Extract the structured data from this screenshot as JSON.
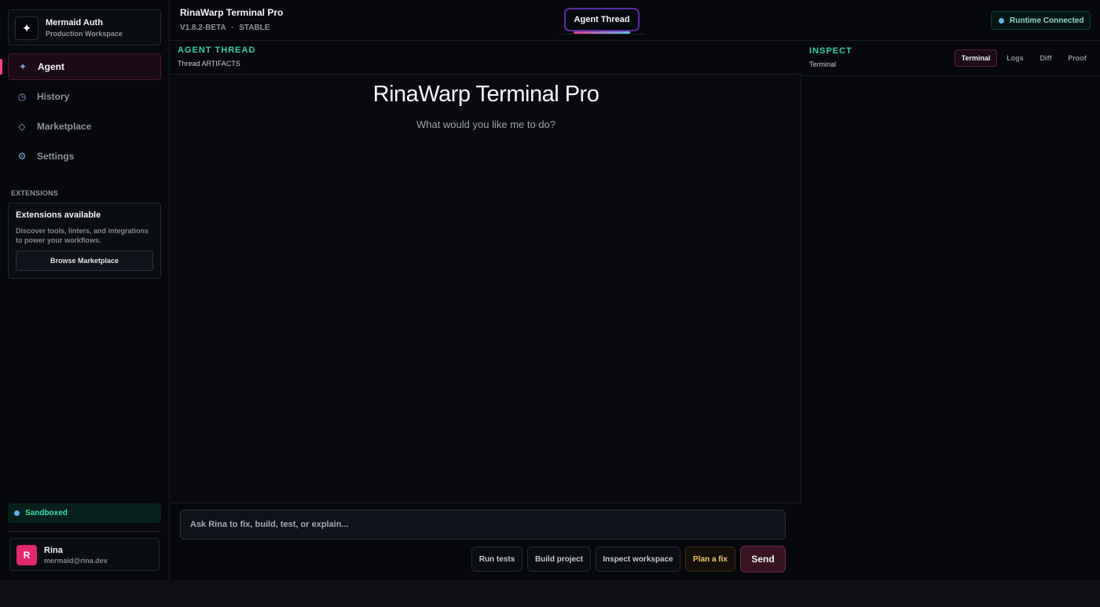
{
  "workspace": {
    "name": "Mermaid Auth",
    "subtitle": "Production Workspace",
    "logo_icon": "sparkle-icon"
  },
  "nav": [
    {
      "label": "Agent",
      "icon": "sparkle-icon",
      "glyph": "✦",
      "active": true
    },
    {
      "label": "History",
      "icon": "clock-icon",
      "glyph": "◷",
      "active": false
    },
    {
      "label": "Marketplace",
      "icon": "diamond-icon",
      "glyph": "◇",
      "active": false
    },
    {
      "label": "Settings",
      "icon": "gear-icon",
      "glyph": "⚙",
      "active": false
    }
  ],
  "extensions": {
    "header": "EXTENSIONS",
    "card_title": "Extensions available",
    "card_desc": "Discover tools, linters, and integrations to power your workflows.",
    "button": "Browse Marketplace"
  },
  "sandbox": {
    "label": "Sandboxed"
  },
  "user": {
    "initial": "R",
    "name": "Rina",
    "email": "mermaid@rina.dev"
  },
  "header": {
    "title": "RinaWarp Terminal Pro",
    "version": "V1.8.2-BETA",
    "separator": "·",
    "channel": "STABLE",
    "active_tab": "Agent Thread",
    "runtime_status": "Runtime Connected"
  },
  "thread": {
    "label": "AGENT THREAD",
    "sublabel": "Thread ARTIFACTS",
    "hero_title": "RinaWarp Terminal Pro",
    "hero_subtitle": "What would you like me to do?"
  },
  "composer": {
    "placeholder": "Ask Rina to fix, build, test, or explain...",
    "chips": [
      "Run tests",
      "Build project",
      "Inspect workspace",
      "Plan a fix"
    ],
    "send": "Send"
  },
  "inspect": {
    "label": "INSPECT",
    "sublabel": "Terminal",
    "tabs": [
      "Terminal",
      "Logs",
      "Diff",
      "Proof"
    ],
    "active_tab": "Terminal"
  },
  "colors": {
    "accent_pink": "#ff3d84",
    "accent_green": "#2fd3a0",
    "accent_blue": "#5fb6e8",
    "accent_purple": "#5b2aa8"
  }
}
